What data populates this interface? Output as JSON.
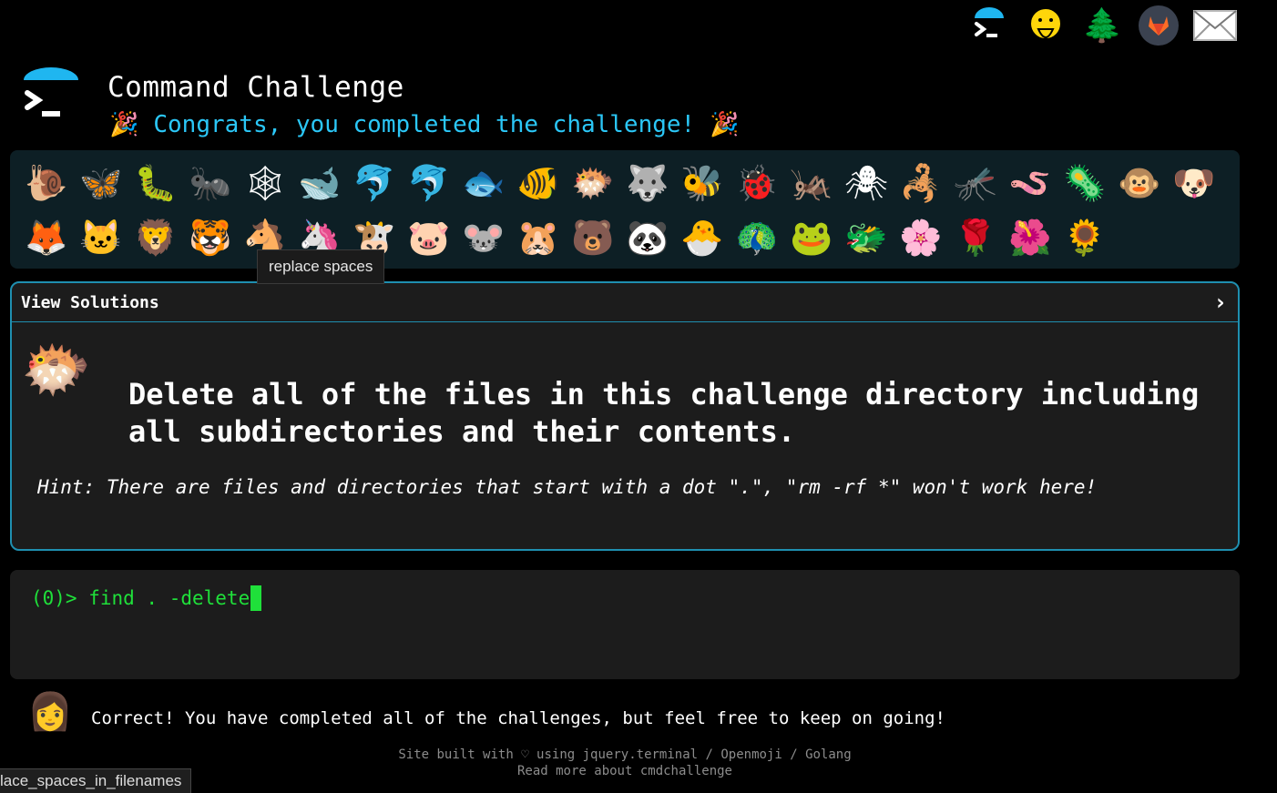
{
  "nav": {
    "icons": [
      "terminal-icon",
      "face-hand-over-mouth-icon",
      "tree-icon",
      "gitlab-icon",
      "mail-icon"
    ],
    "tree_glyph": "🌲"
  },
  "header": {
    "title": "Command Challenge",
    "congrats": "Congrats, you completed the challenge!",
    "party_glyph": "🎉"
  },
  "tray": {
    "row1": [
      "🐌",
      "🦋",
      "🐛",
      "🐜",
      "🕸",
      "🐋",
      "🐬",
      "🐬",
      "🐟",
      "🐠",
      "🐡",
      "🐺",
      "🐝",
      "🐞",
      "🦗",
      "🕷",
      "🦂",
      "🦟",
      "🪱",
      "🦠",
      "🐵",
      "🐶"
    ],
    "row2": [
      "🦊",
      "🐱",
      "🦁",
      "🐯",
      "🐴",
      "🦄",
      "🐮",
      "🐷",
      "🐭",
      "🐹",
      "🐻",
      "🐼",
      "🐣",
      "🦚",
      "🐸",
      "🐲",
      "🌸",
      "🌹",
      "🌺",
      "🌻"
    ]
  },
  "tooltip": "replace spaces",
  "panel": {
    "header_label": "View Solutions",
    "chevron": "›",
    "challenge_glyph": "🐡",
    "task": "Delete all of the files in this challenge directory including all subdirectories and their contents.",
    "hint": "Hint: There are files and directories that start with a dot \".\", \"rm -rf *\" won't work here!"
  },
  "terminal": {
    "prompt": "(0)> ",
    "command": "find . -delete"
  },
  "result": {
    "glyph": "👩",
    "text": "Correct! You have completed all of the challenges, but feel free to keep on going!"
  },
  "footer": {
    "line1": "Site built with ♡ using jquery.terminal / Openmoji / Golang",
    "line2": "Read more about cmdchallenge"
  },
  "statusbar": "lace_spaces_in_filenames"
}
